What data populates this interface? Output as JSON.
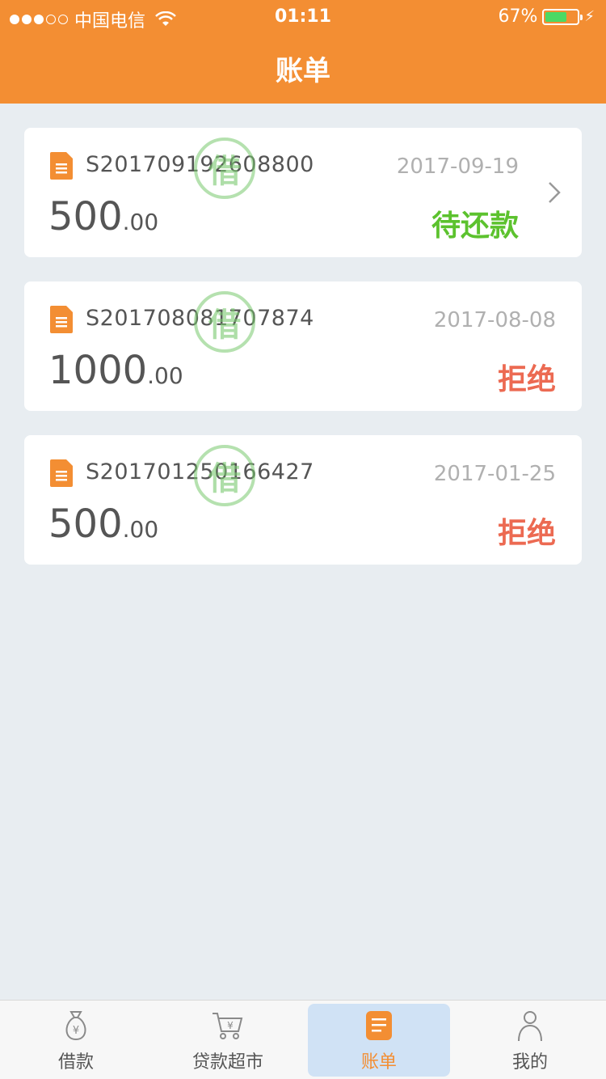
{
  "status_bar": {
    "carrier": "中国电信",
    "time": "01:11",
    "battery": "67%",
    "battery_level": 0.67
  },
  "header": {
    "title": "账单"
  },
  "colors": {
    "accent": "#f38e33",
    "pending": "#5cc22e",
    "rejected": "#ec6a52",
    "stamp": "#78c86e"
  },
  "stamp_text": "借",
  "bills": [
    {
      "number": "S201709192608800",
      "date": "2017-09-19",
      "amount_int": "500",
      "amount_dec": ".00",
      "status": "待还款",
      "status_type": "pending"
    },
    {
      "number": "S201708081707874",
      "date": "2017-08-08",
      "amount_int": "1000",
      "amount_dec": ".00",
      "status": "拒绝",
      "status_type": "rejected"
    },
    {
      "number": "S201701250166427",
      "date": "2017-01-25",
      "amount_int": "500",
      "amount_dec": ".00",
      "status": "拒绝",
      "status_type": "rejected"
    }
  ],
  "tabs": [
    {
      "label": "借款",
      "icon": "money-bag-icon"
    },
    {
      "label": "贷款超市",
      "icon": "cart-icon"
    },
    {
      "label": "账单",
      "icon": "bill-icon",
      "active": true
    },
    {
      "label": "我的",
      "icon": "person-icon"
    }
  ]
}
